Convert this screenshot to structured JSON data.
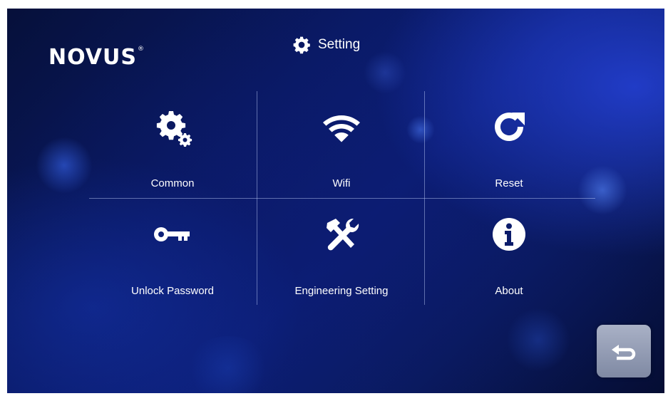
{
  "header": {
    "brand": "NOVUS",
    "brand_mark": "®",
    "title": "Setting",
    "title_icon": "gear-icon"
  },
  "menu": {
    "items": [
      {
        "id": "common",
        "label": "Common",
        "icon": "gears-icon"
      },
      {
        "id": "wifi",
        "label": "Wifi",
        "icon": "wifi-icon"
      },
      {
        "id": "reset",
        "label": "Reset",
        "icon": "refresh-icon"
      },
      {
        "id": "unlock-password",
        "label": "Unlock Password",
        "icon": "key-icon"
      },
      {
        "id": "engineering-setting",
        "label": "Engineering Setting",
        "icon": "tools-icon"
      },
      {
        "id": "about",
        "label": "About",
        "icon": "info-icon"
      }
    ]
  },
  "footer": {
    "back_icon": "back-arrow-icon"
  },
  "colors": {
    "background_dark": "#06103a",
    "background_mid": "#0c1f78",
    "text": "#ffffff",
    "back_button": "#8a93ab",
    "divider": "#c8d7ff"
  }
}
